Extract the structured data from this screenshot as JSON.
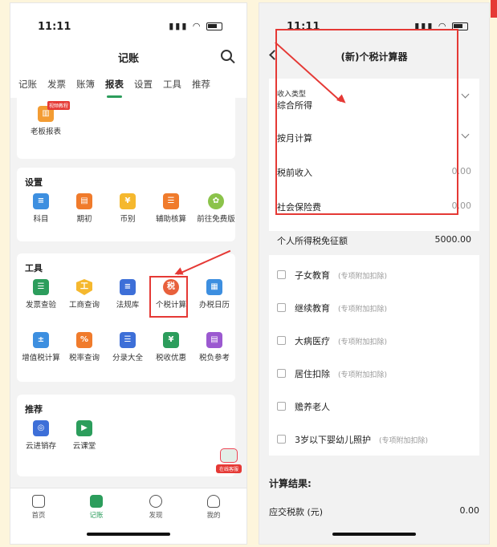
{
  "left": {
    "status_time": "11:11",
    "title": "记账",
    "tabs": [
      "记账",
      "发票",
      "账簿",
      "报表",
      "设置",
      "工具",
      "推荐"
    ],
    "active_tab": "报表",
    "report_card": {
      "item": "老板报表",
      "badge": "视频教程"
    },
    "settings": {
      "heading": "设置",
      "items": [
        "科目",
        "期初",
        "币别",
        "辅助核算",
        "前往免费版"
      ]
    },
    "tools": {
      "heading": "工具",
      "row1": [
        "发票查验",
        "工商查询",
        "法规库",
        "个税计算",
        "办税日历"
      ],
      "row2": [
        "增值税计算",
        "税率查询",
        "分录大全",
        "税收优惠",
        "税负参考"
      ],
      "tax_glyph": "税",
      "yen_glyph": "¥"
    },
    "recommend": {
      "heading": "推荐",
      "items": [
        "云进销存",
        "云课堂"
      ]
    },
    "fab_label": "在线客服",
    "tabbar": [
      "首页",
      "记账",
      "发现",
      "我的"
    ],
    "colors": {
      "accent": "#2c9d5c",
      "highlight": "#e53935"
    }
  },
  "right": {
    "status_time": "11:11",
    "title": "(新)个税计算器",
    "income_type_label": "收入类型",
    "income_type_value": "综合所得",
    "calc_mode": "按月计算",
    "pretax_label": "税前收入",
    "pretax_value": "0.00",
    "social_label": "社会保险费",
    "social_value": "0.00",
    "threshold_label": "个人所得税免征额",
    "threshold_value": "5000.00",
    "deductions": [
      {
        "label": "子女教育",
        "tag": "(专项附加扣除)"
      },
      {
        "label": "继续教育",
        "tag": "(专项附加扣除)"
      },
      {
        "label": "大病医疗",
        "tag": "(专项附加扣除)"
      },
      {
        "label": "居住扣除",
        "tag": "(专项附加扣除)"
      },
      {
        "label": "赡养老人",
        "tag": ""
      },
      {
        "label": "3岁以下婴幼儿照护",
        "tag": "(专项附加扣除)"
      }
    ],
    "result_heading": "计算结果:",
    "tax_due_label": "应交税款 (元)",
    "tax_due_value": "0.00"
  }
}
